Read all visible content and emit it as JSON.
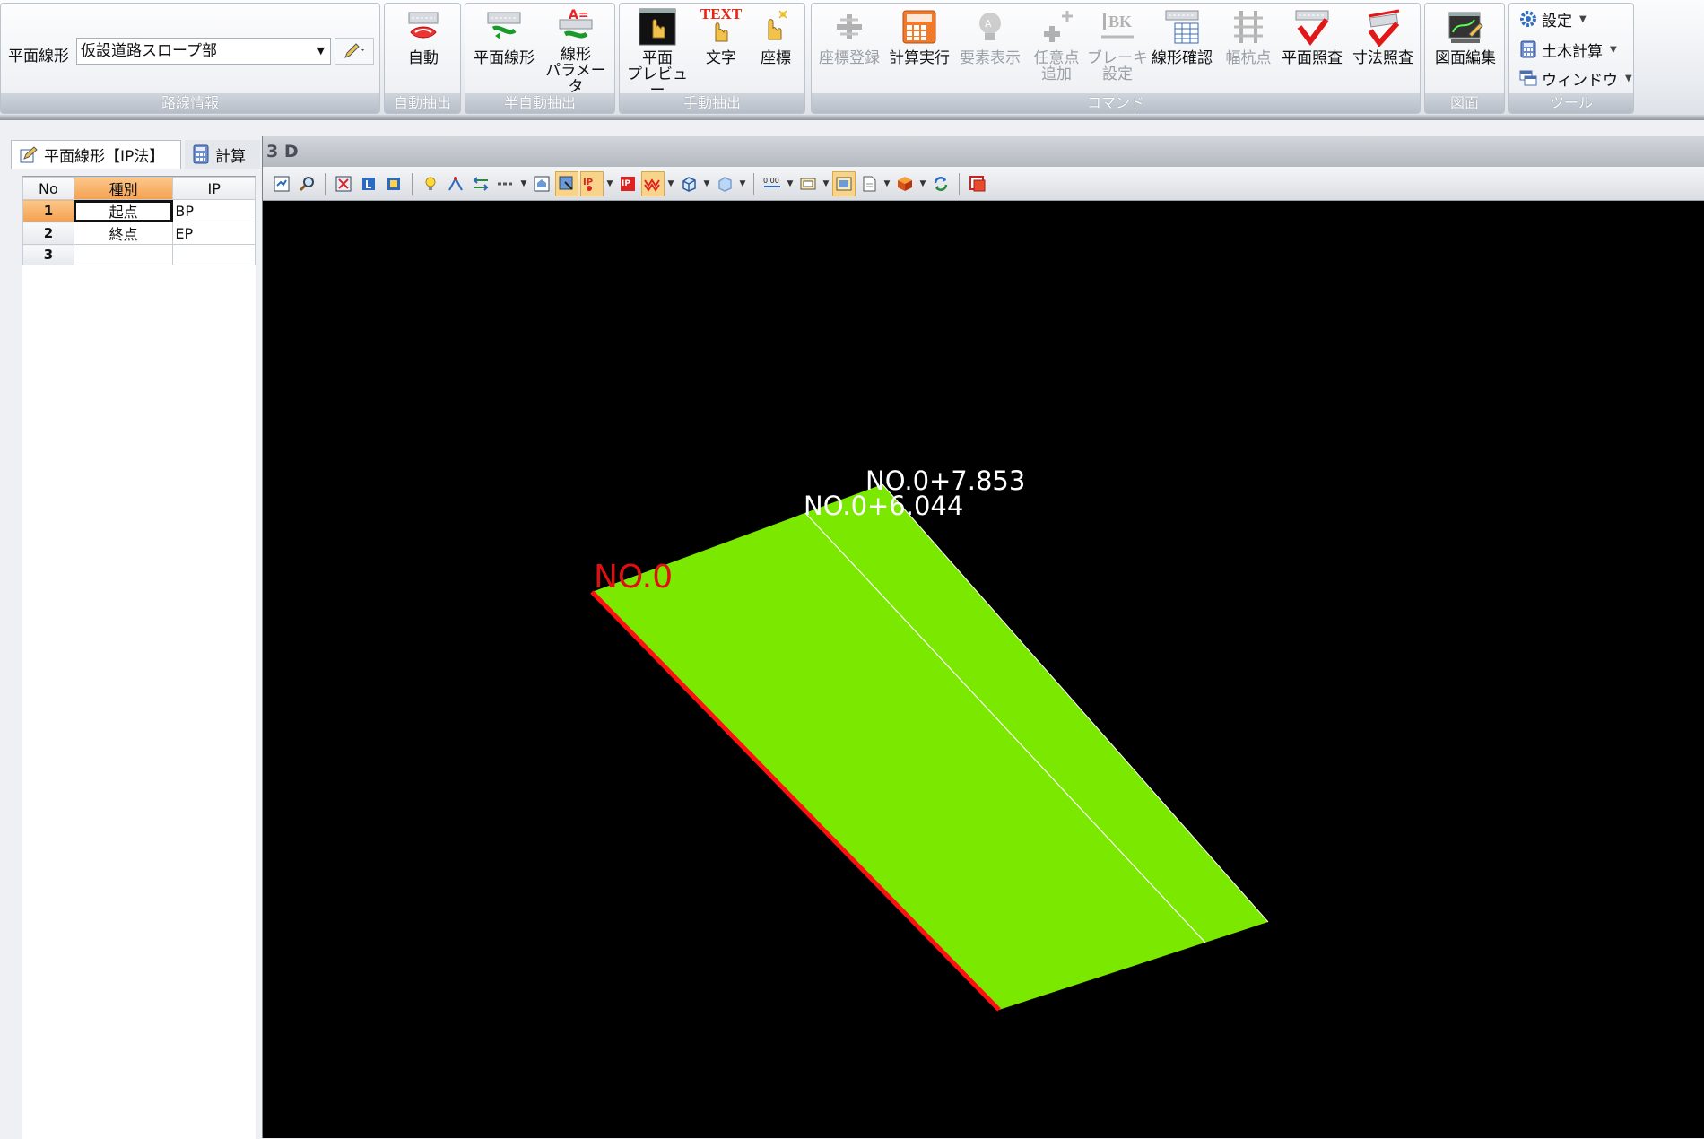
{
  "ribbon": {
    "route_info": {
      "label": "平面線形",
      "combo_value": "仮設道路スロープ部",
      "group_label": "路線情報"
    },
    "auto_extract": {
      "buttons": [
        {
          "label": "自動",
          "icon": "auto-extract-icon"
        }
      ],
      "group_label": "自動抽出"
    },
    "semi_auto": {
      "buttons": [
        {
          "label": "平面線形",
          "icon": "plane-alignment-icon"
        },
        {
          "label": "線形\nパラメータ",
          "icon": "alignment-parameter-icon"
        }
      ],
      "group_label": "半自動抽出"
    },
    "manual": {
      "buttons": [
        {
          "label": "平面\nプレビュー",
          "icon": "plane-preview-icon"
        },
        {
          "label": "文字",
          "icon": "text-pick-icon",
          "badge": "TEXT"
        },
        {
          "label": "座標",
          "icon": "coordinate-pick-icon"
        }
      ],
      "group_label": "手動抽出"
    },
    "command": {
      "buttons": [
        {
          "label": "座標登録",
          "icon": "coordinate-register-icon",
          "enabled": false
        },
        {
          "label": "計算実行",
          "icon": "calculate-icon",
          "enabled": true
        },
        {
          "label": "要素表示",
          "icon": "element-display-icon",
          "enabled": false
        },
        {
          "label": "任意点\n追加",
          "icon": "add-point-icon",
          "enabled": false
        },
        {
          "label": "ブレーキ\n設定",
          "icon": "break-setting-icon",
          "badge": "BK",
          "enabled": false
        },
        {
          "label": "線形確認",
          "icon": "alignment-check-icon",
          "enabled": true
        },
        {
          "label": "幅杭点",
          "icon": "width-stake-icon",
          "enabled": false
        },
        {
          "label": "平面照査",
          "icon": "plane-check-icon",
          "enabled": true
        },
        {
          "label": "寸法照査",
          "icon": "dimension-check-icon",
          "enabled": true
        }
      ],
      "group_label": "コマンド"
    },
    "drawing": {
      "buttons": [
        {
          "label": "図面編集",
          "icon": "drawing-edit-icon"
        }
      ],
      "group_label": "図面"
    },
    "tools": {
      "items": [
        {
          "label": "設定",
          "icon": "settings-gear-icon"
        },
        {
          "label": "土木計算",
          "icon": "civil-calc-icon"
        },
        {
          "label": "ウィンドウ",
          "icon": "window-icon"
        }
      ],
      "group_label": "ツール"
    }
  },
  "left_panel": {
    "tabs": [
      {
        "label": "平面線形【IP法】",
        "icon": "edit-note-icon",
        "active": true
      },
      {
        "label": "計算",
        "icon": "calculator-icon",
        "active": false
      }
    ],
    "grid": {
      "headers": [
        "No",
        "種別",
        "IP"
      ],
      "rows": [
        {
          "no": "1",
          "kind": "起点",
          "ip": "BP"
        },
        {
          "no": "2",
          "kind": "終点",
          "ip": "EP"
        },
        {
          "no": "3",
          "kind": "",
          "ip": ""
        }
      ]
    }
  },
  "viewer": {
    "title": "3 D",
    "labels": {
      "start": "NO.0",
      "mid": "NO.0+6.044",
      "end": "NO.0+7.853"
    },
    "colors": {
      "background": "#000000",
      "surface": "#7be800",
      "start_edge": "#ff1010",
      "center_line": "#ffffff",
      "label_white": "#ffffff",
      "label_red": "#e01010"
    }
  }
}
